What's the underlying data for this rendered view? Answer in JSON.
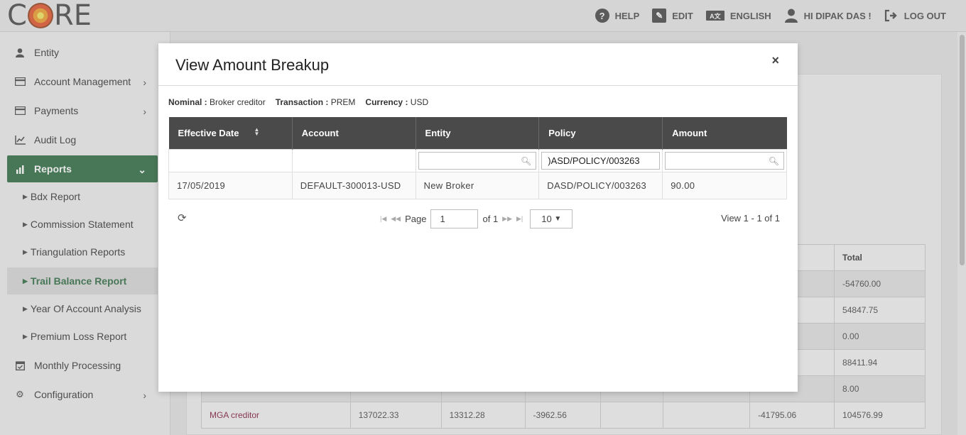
{
  "header": {
    "logo_c": "C",
    "logo_re": "RE",
    "nav": [
      {
        "label": "HELP",
        "icon": "help-icon"
      },
      {
        "label": "EDIT",
        "icon": "edit-icon"
      },
      {
        "label": "ENGLISH",
        "icon": "language-icon"
      },
      {
        "label": "HI DIPAK DAS !",
        "icon": "user-icon"
      },
      {
        "label": "LOG OUT",
        "icon": "logout-icon"
      }
    ]
  },
  "sidebar": {
    "items": [
      {
        "label": "Entity"
      },
      {
        "label": "Account Management"
      },
      {
        "label": "Payments"
      },
      {
        "label": "Audit Log"
      },
      {
        "label": "Reports"
      },
      {
        "label": "Monthly Processing"
      },
      {
        "label": "Configuration"
      }
    ],
    "report_subitems": [
      {
        "label": "Bdx Report"
      },
      {
        "label": "Commission Statement"
      },
      {
        "label": "Triangulation Reports"
      },
      {
        "label": "Trail Balance Report"
      },
      {
        "label": "Year Of Account Analysis"
      },
      {
        "label": "Premium Loss Report"
      }
    ]
  },
  "background_table": {
    "total_header": "Total",
    "totals": [
      "-54760.00",
      "54847.75",
      "0.00",
      "88411.94",
      "8.00"
    ],
    "last_row": [
      "MGA creditor",
      "137022.33",
      "13312.28",
      "-3962.56",
      "",
      "",
      "-41795.06",
      "104576.99"
    ]
  },
  "modal": {
    "title": "View Amount Breakup",
    "close": "×",
    "meta": {
      "nominal_label": "Nominal :",
      "nominal_value": "Broker creditor",
      "transaction_label": "Transaction :",
      "transaction_value": "PREM",
      "currency_label": "Currency :",
      "currency_value": "USD"
    },
    "columns": [
      "Effective Date",
      "Account",
      "Entity",
      "Policy",
      "Amount"
    ],
    "filters": {
      "entity": "",
      "policy": ")ASD/POLICY/003263",
      "amount": ""
    },
    "rows": [
      [
        "17/05/2019",
        "DEFAULT-300013-USD",
        "New Broker",
        "DASD/POLICY/003263",
        "90.00"
      ]
    ],
    "pager": {
      "page_label": "Page",
      "page_value": "1",
      "of_label": "of 1",
      "page_size": "10",
      "view_text": "View 1 - 1 of 1"
    }
  }
}
